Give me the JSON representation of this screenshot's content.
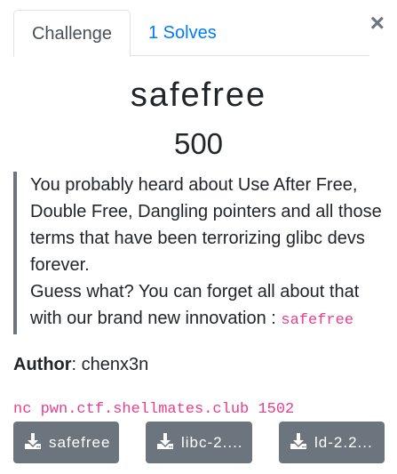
{
  "tabs": [
    {
      "label": "Challenge"
    },
    {
      "label": "1 Solves"
    }
  ],
  "close_label": "×",
  "challenge": {
    "name": "safefree",
    "value": "500"
  },
  "description": {
    "line1": "You probably heard about Use After Free, Double Free, Dangling pointers and all those terms that have been terrorizing glibc devs forever.",
    "line2_prefix": "Guess what? You can forget all about that with our brand new innovation : ",
    "line2_code": "safefree"
  },
  "author": {
    "label": "Author",
    "separator": ": ",
    "name": "chenx3n"
  },
  "connection": "nc pwn.ctf.shellmates.club 1502",
  "files": [
    {
      "label": "safefree",
      "icon": "download-icon"
    },
    {
      "label": "libc-2....",
      "icon": "download-icon"
    },
    {
      "label": "ld-2.2...",
      "icon": "download-icon"
    }
  ],
  "colors": {
    "accent": "#007bff",
    "code": "#e83e8c",
    "button": "#6c757d"
  }
}
